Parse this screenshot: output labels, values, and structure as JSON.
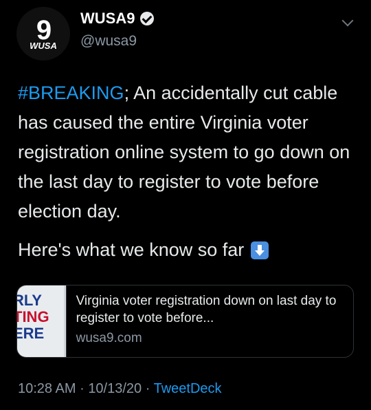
{
  "author": {
    "avatar_logo_number": "9",
    "avatar_logo_text": "WUSA",
    "display_name": "WUSA9",
    "handle": "@wusa9",
    "verified": true
  },
  "tweet": {
    "hashtag": "#BREAKING",
    "text_after_hashtag": "; An accidentally cut cable has caused the entire Virginia voter registration online system to go down on the last day to register to vote before election day.",
    "second_line": "Here's what we know so far",
    "emoji": "down-arrow-emoji"
  },
  "card": {
    "thumb_lines": [
      "RLY",
      "TING",
      "ERE"
    ],
    "title": "Virginia voter registration down on last day to register to vote before...",
    "domain": "wusa9.com"
  },
  "meta": {
    "time": "10:28 AM",
    "separator": "·",
    "date": "10/13/20",
    "source": "TweetDeck"
  },
  "colors": {
    "background": "#000000",
    "link": "#1d9bf0",
    "secondary_text": "#8b98a5"
  }
}
